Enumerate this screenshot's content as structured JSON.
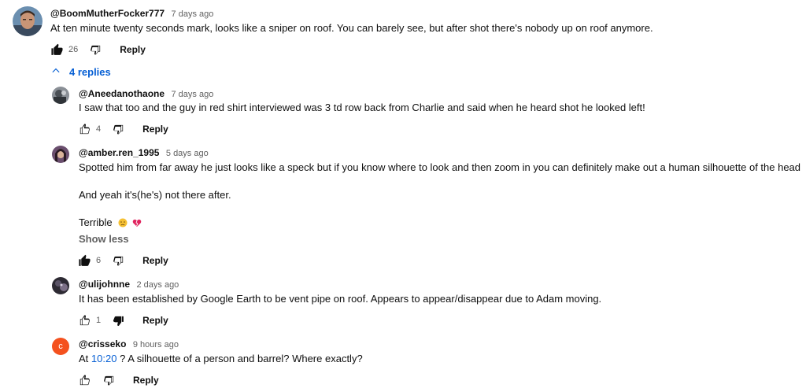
{
  "main_comment": {
    "handle": "@BoomMutherFocker777",
    "time": "7 days ago",
    "text": "At ten minute twenty seconds mark, looks like a sniper on roof. You can barely see, but after shot there's nobody up on roof anymore.",
    "likes": "26",
    "reply_label": "Reply"
  },
  "replies_toggle": {
    "label": "4 replies",
    "icon": "chevron-up-icon"
  },
  "replies": [
    {
      "handle": "@Aneedanothaone",
      "time": "7 days ago",
      "text": "I saw that too and the guy in red shirt interviewed was 3 td row back from Charlie and said when he heard shot he looked left!",
      "likes": "4",
      "reply_label": "Reply"
    },
    {
      "handle": "@amber.ren_1995",
      "time": "5 days ago",
      "text_line1": "Spotted him from far away he just looks like a speck but if you know where to look and then zoom in you can definitely make out a human silhouette of the head",
      "text_line1_end": ".",
      "text_line2": "And yeah it's(he's) not there after.",
      "text_line3": "Terrible",
      "show_less": "Show less",
      "likes": "6",
      "reply_label": "Reply"
    },
    {
      "handle": "@ulijohnne",
      "time": "2 days ago",
      "text": "It has been established by Google Earth to be vent pipe on roof. Appears to appear/disappear due to Adam moving.",
      "likes": "1",
      "reply_label": "Reply"
    },
    {
      "handle": "@crisseko",
      "time": "9 hours ago",
      "avatar_letter": "c",
      "text_prefix": "At",
      "timestamp_link": "10:20",
      "text_suffix": "? A silhouette of a person and barrel? Where exactly?",
      "reply_label": "Reply"
    }
  ],
  "colors": {
    "link": "#065fd4",
    "secondary_text": "#606060",
    "avatar_crisseko": "#f4511e"
  }
}
